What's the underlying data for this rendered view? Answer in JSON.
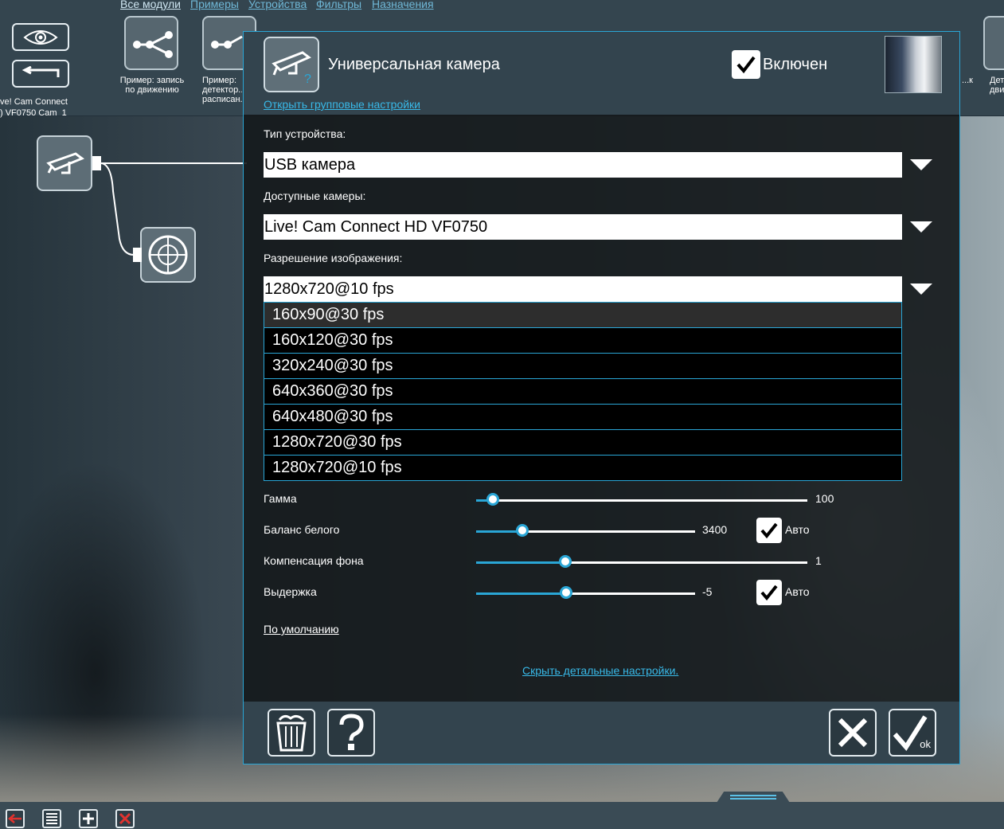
{
  "nav_tabs": [
    "Все модули",
    "Примеры",
    "Устройства",
    "Фильтры",
    "Назначения"
  ],
  "modules": [
    {
      "label": "Пример: запись по движению"
    },
    {
      "label": "Пример: детектор... расписан..."
    },
    {
      "label": "...к"
    },
    {
      "label": "Дет... дви..."
    }
  ],
  "camera_node_label": "ve! Cam Connect\n) VF0750 Cam  1",
  "dialog": {
    "title": "Универсальная камера",
    "enabled_label": "Включен",
    "enabled_checked": true,
    "group_settings_link": "Открыть групповые настройки",
    "device_type_label": "Тип устройства:",
    "device_type_value": "USB камера",
    "cameras_label": "Доступные камеры:",
    "camera_value": "Live! Cam Connect HD VF0750",
    "resolution_label": "Разрешение изображения:",
    "resolution_value": "1280x720@10 fps",
    "resolution_options": [
      "160x90@30 fps",
      "160x120@30 fps",
      "320x240@30 fps",
      "640x360@30 fps",
      "640x480@30 fps",
      "1280x720@30 fps",
      "1280x720@10 fps"
    ],
    "highlighted_option_index": 0,
    "sliders": [
      {
        "label": "Гамма",
        "value": "100",
        "level": 0.05,
        "auto": null
      },
      {
        "label": "Баланс белого",
        "value": "3400",
        "level": 0.21,
        "auto": "Авто"
      },
      {
        "label": "Компенсация фона",
        "value": "1",
        "level": 0.27,
        "auto": null
      },
      {
        "label": "Выдержка",
        "value": "-5",
        "level": 0.41,
        "auto": "Авто"
      }
    ],
    "default_link": "По умолчанию",
    "hide_details_link": "Скрыть детальные настройки.",
    "ok_label": "ok"
  },
  "colors": {
    "accent": "#2aa6d6",
    "panel": "#33444e",
    "link": "#38b9e8"
  }
}
